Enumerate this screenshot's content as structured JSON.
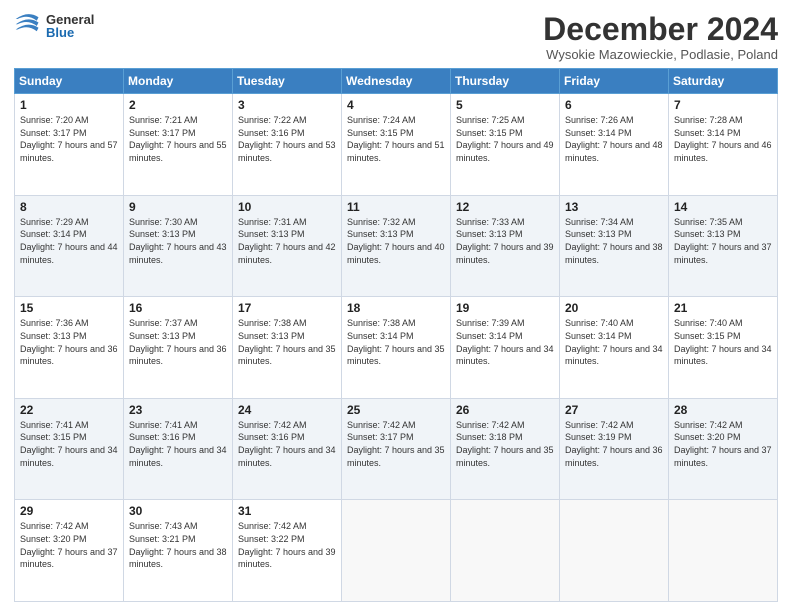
{
  "logo": {
    "general": "General",
    "blue": "Blue"
  },
  "title": "December 2024",
  "subtitle": "Wysokie Mazowieckie, Podlasie, Poland",
  "days_header": [
    "Sunday",
    "Monday",
    "Tuesday",
    "Wednesday",
    "Thursday",
    "Friday",
    "Saturday"
  ],
  "weeks": [
    [
      {
        "day": "1",
        "sunrise": "Sunrise: 7:20 AM",
        "sunset": "Sunset: 3:17 PM",
        "daylight": "Daylight: 7 hours and 57 minutes."
      },
      {
        "day": "2",
        "sunrise": "Sunrise: 7:21 AM",
        "sunset": "Sunset: 3:17 PM",
        "daylight": "Daylight: 7 hours and 55 minutes."
      },
      {
        "day": "3",
        "sunrise": "Sunrise: 7:22 AM",
        "sunset": "Sunset: 3:16 PM",
        "daylight": "Daylight: 7 hours and 53 minutes."
      },
      {
        "day": "4",
        "sunrise": "Sunrise: 7:24 AM",
        "sunset": "Sunset: 3:15 PM",
        "daylight": "Daylight: 7 hours and 51 minutes."
      },
      {
        "day": "5",
        "sunrise": "Sunrise: 7:25 AM",
        "sunset": "Sunset: 3:15 PM",
        "daylight": "Daylight: 7 hours and 49 minutes."
      },
      {
        "day": "6",
        "sunrise": "Sunrise: 7:26 AM",
        "sunset": "Sunset: 3:14 PM",
        "daylight": "Daylight: 7 hours and 48 minutes."
      },
      {
        "day": "7",
        "sunrise": "Sunrise: 7:28 AM",
        "sunset": "Sunset: 3:14 PM",
        "daylight": "Daylight: 7 hours and 46 minutes."
      }
    ],
    [
      {
        "day": "8",
        "sunrise": "Sunrise: 7:29 AM",
        "sunset": "Sunset: 3:14 PM",
        "daylight": "Daylight: 7 hours and 44 minutes."
      },
      {
        "day": "9",
        "sunrise": "Sunrise: 7:30 AM",
        "sunset": "Sunset: 3:13 PM",
        "daylight": "Daylight: 7 hours and 43 minutes."
      },
      {
        "day": "10",
        "sunrise": "Sunrise: 7:31 AM",
        "sunset": "Sunset: 3:13 PM",
        "daylight": "Daylight: 7 hours and 42 minutes."
      },
      {
        "day": "11",
        "sunrise": "Sunrise: 7:32 AM",
        "sunset": "Sunset: 3:13 PM",
        "daylight": "Daylight: 7 hours and 40 minutes."
      },
      {
        "day": "12",
        "sunrise": "Sunrise: 7:33 AM",
        "sunset": "Sunset: 3:13 PM",
        "daylight": "Daylight: 7 hours and 39 minutes."
      },
      {
        "day": "13",
        "sunrise": "Sunrise: 7:34 AM",
        "sunset": "Sunset: 3:13 PM",
        "daylight": "Daylight: 7 hours and 38 minutes."
      },
      {
        "day": "14",
        "sunrise": "Sunrise: 7:35 AM",
        "sunset": "Sunset: 3:13 PM",
        "daylight": "Daylight: 7 hours and 37 minutes."
      }
    ],
    [
      {
        "day": "15",
        "sunrise": "Sunrise: 7:36 AM",
        "sunset": "Sunset: 3:13 PM",
        "daylight": "Daylight: 7 hours and 36 minutes."
      },
      {
        "day": "16",
        "sunrise": "Sunrise: 7:37 AM",
        "sunset": "Sunset: 3:13 PM",
        "daylight": "Daylight: 7 hours and 36 minutes."
      },
      {
        "day": "17",
        "sunrise": "Sunrise: 7:38 AM",
        "sunset": "Sunset: 3:13 PM",
        "daylight": "Daylight: 7 hours and 35 minutes."
      },
      {
        "day": "18",
        "sunrise": "Sunrise: 7:38 AM",
        "sunset": "Sunset: 3:14 PM",
        "daylight": "Daylight: 7 hours and 35 minutes."
      },
      {
        "day": "19",
        "sunrise": "Sunrise: 7:39 AM",
        "sunset": "Sunset: 3:14 PM",
        "daylight": "Daylight: 7 hours and 34 minutes."
      },
      {
        "day": "20",
        "sunrise": "Sunrise: 7:40 AM",
        "sunset": "Sunset: 3:14 PM",
        "daylight": "Daylight: 7 hours and 34 minutes."
      },
      {
        "day": "21",
        "sunrise": "Sunrise: 7:40 AM",
        "sunset": "Sunset: 3:15 PM",
        "daylight": "Daylight: 7 hours and 34 minutes."
      }
    ],
    [
      {
        "day": "22",
        "sunrise": "Sunrise: 7:41 AM",
        "sunset": "Sunset: 3:15 PM",
        "daylight": "Daylight: 7 hours and 34 minutes."
      },
      {
        "day": "23",
        "sunrise": "Sunrise: 7:41 AM",
        "sunset": "Sunset: 3:16 PM",
        "daylight": "Daylight: 7 hours and 34 minutes."
      },
      {
        "day": "24",
        "sunrise": "Sunrise: 7:42 AM",
        "sunset": "Sunset: 3:16 PM",
        "daylight": "Daylight: 7 hours and 34 minutes."
      },
      {
        "day": "25",
        "sunrise": "Sunrise: 7:42 AM",
        "sunset": "Sunset: 3:17 PM",
        "daylight": "Daylight: 7 hours and 35 minutes."
      },
      {
        "day": "26",
        "sunrise": "Sunrise: 7:42 AM",
        "sunset": "Sunset: 3:18 PM",
        "daylight": "Daylight: 7 hours and 35 minutes."
      },
      {
        "day": "27",
        "sunrise": "Sunrise: 7:42 AM",
        "sunset": "Sunset: 3:19 PM",
        "daylight": "Daylight: 7 hours and 36 minutes."
      },
      {
        "day": "28",
        "sunrise": "Sunrise: 7:42 AM",
        "sunset": "Sunset: 3:20 PM",
        "daylight": "Daylight: 7 hours and 37 minutes."
      }
    ],
    [
      {
        "day": "29",
        "sunrise": "Sunrise: 7:42 AM",
        "sunset": "Sunset: 3:20 PM",
        "daylight": "Daylight: 7 hours and 37 minutes."
      },
      {
        "day": "30",
        "sunrise": "Sunrise: 7:43 AM",
        "sunset": "Sunset: 3:21 PM",
        "daylight": "Daylight: 7 hours and 38 minutes."
      },
      {
        "day": "31",
        "sunrise": "Sunrise: 7:42 AM",
        "sunset": "Sunset: 3:22 PM",
        "daylight": "Daylight: 7 hours and 39 minutes."
      },
      null,
      null,
      null,
      null
    ]
  ]
}
